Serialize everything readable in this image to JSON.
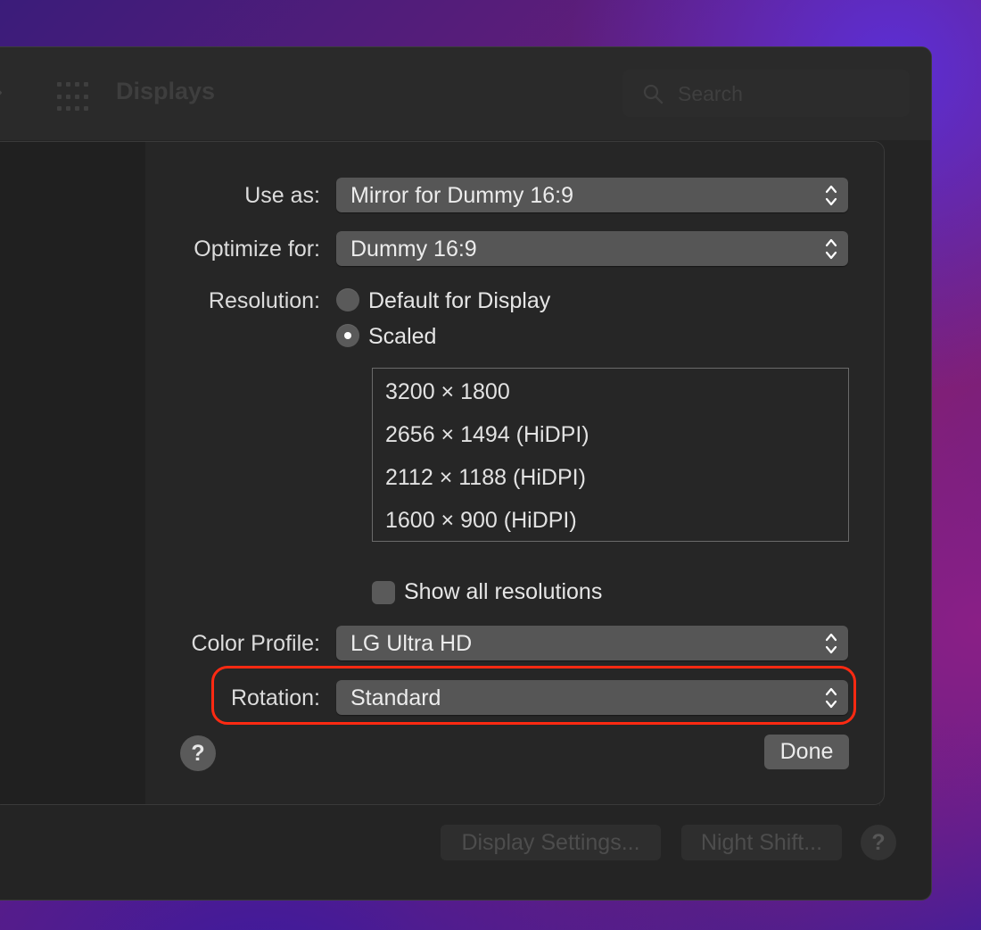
{
  "window": {
    "title": "Displays",
    "search_placeholder": "Search",
    "footer": {
      "display_settings_label": "Display Settings...",
      "night_shift_label": "Night Shift...",
      "help_label": "?"
    }
  },
  "sheet": {
    "use_as": {
      "label": "Use as:",
      "value": "Mirror for Dummy 16:9"
    },
    "optimize_for": {
      "label": "Optimize for:",
      "value": "Dummy 16:9"
    },
    "resolution": {
      "label": "Resolution:",
      "options": [
        "Default for Display",
        "Scaled"
      ],
      "selected": "Scaled",
      "list": [
        "3200 × 1800",
        "2656 × 1494 (HiDPI)",
        "2112 × 1188 (HiDPI)",
        "1600 × 900 (HiDPI)"
      ]
    },
    "show_all_resolutions": {
      "label": "Show all resolutions",
      "checked": false
    },
    "color_profile": {
      "label": "Color Profile:",
      "value": "LG Ultra HD"
    },
    "rotation": {
      "label": "Rotation:",
      "value": "Standard"
    },
    "help_label": "?",
    "done_label": "Done"
  },
  "colors": {
    "highlight": "#ff2a12",
    "popup_bg": "#565656",
    "window_bg": "#242424"
  }
}
